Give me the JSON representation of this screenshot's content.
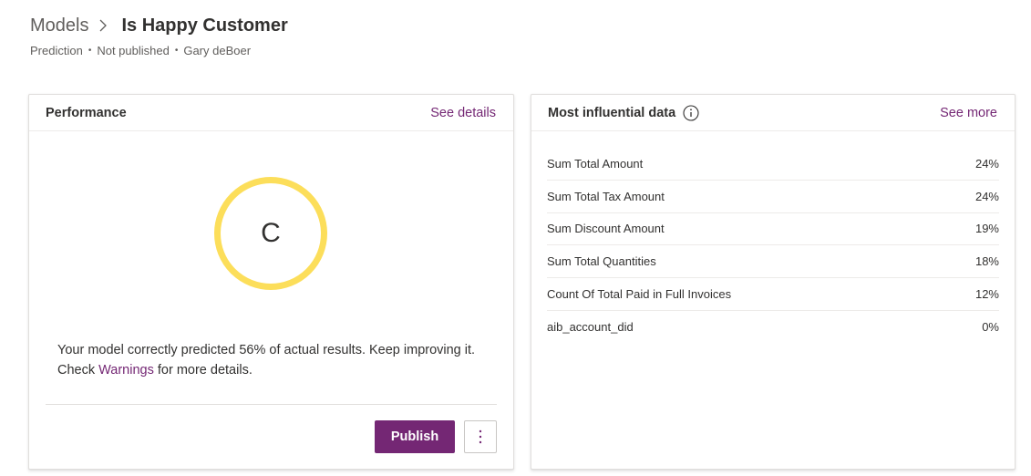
{
  "breadcrumb": {
    "root": "Models",
    "current": "Is Happy Customer"
  },
  "meta": {
    "type": "Prediction",
    "status": "Not published",
    "owner": "Gary deBoer",
    "separator": "•"
  },
  "performance": {
    "title": "Performance",
    "link": "See details",
    "grade": "C",
    "grade_color": "#fcde5a",
    "message_before": "Your model correctly predicted 56% of actual results. Keep improving it. Check ",
    "message_link": "Warnings",
    "message_after": " for more details.",
    "publish_label": "Publish",
    "more_icon": "more-vertical-icon"
  },
  "influential": {
    "title": "Most influential data",
    "info_icon": "info-icon",
    "link": "See more",
    "rows": [
      {
        "name": "Sum Total Amount",
        "value": "24%"
      },
      {
        "name": "Sum Total Tax Amount",
        "value": "24%"
      },
      {
        "name": "Sum Discount Amount",
        "value": "19%"
      },
      {
        "name": "Sum Total Quantities",
        "value": "18%"
      },
      {
        "name": "Count Of Total Paid in Full Invoices",
        "value": "12%"
      },
      {
        "name": "aib_account_did",
        "value": "0%"
      }
    ]
  },
  "colors": {
    "accent": "#742774",
    "grade_ring": "#fcde5a"
  }
}
